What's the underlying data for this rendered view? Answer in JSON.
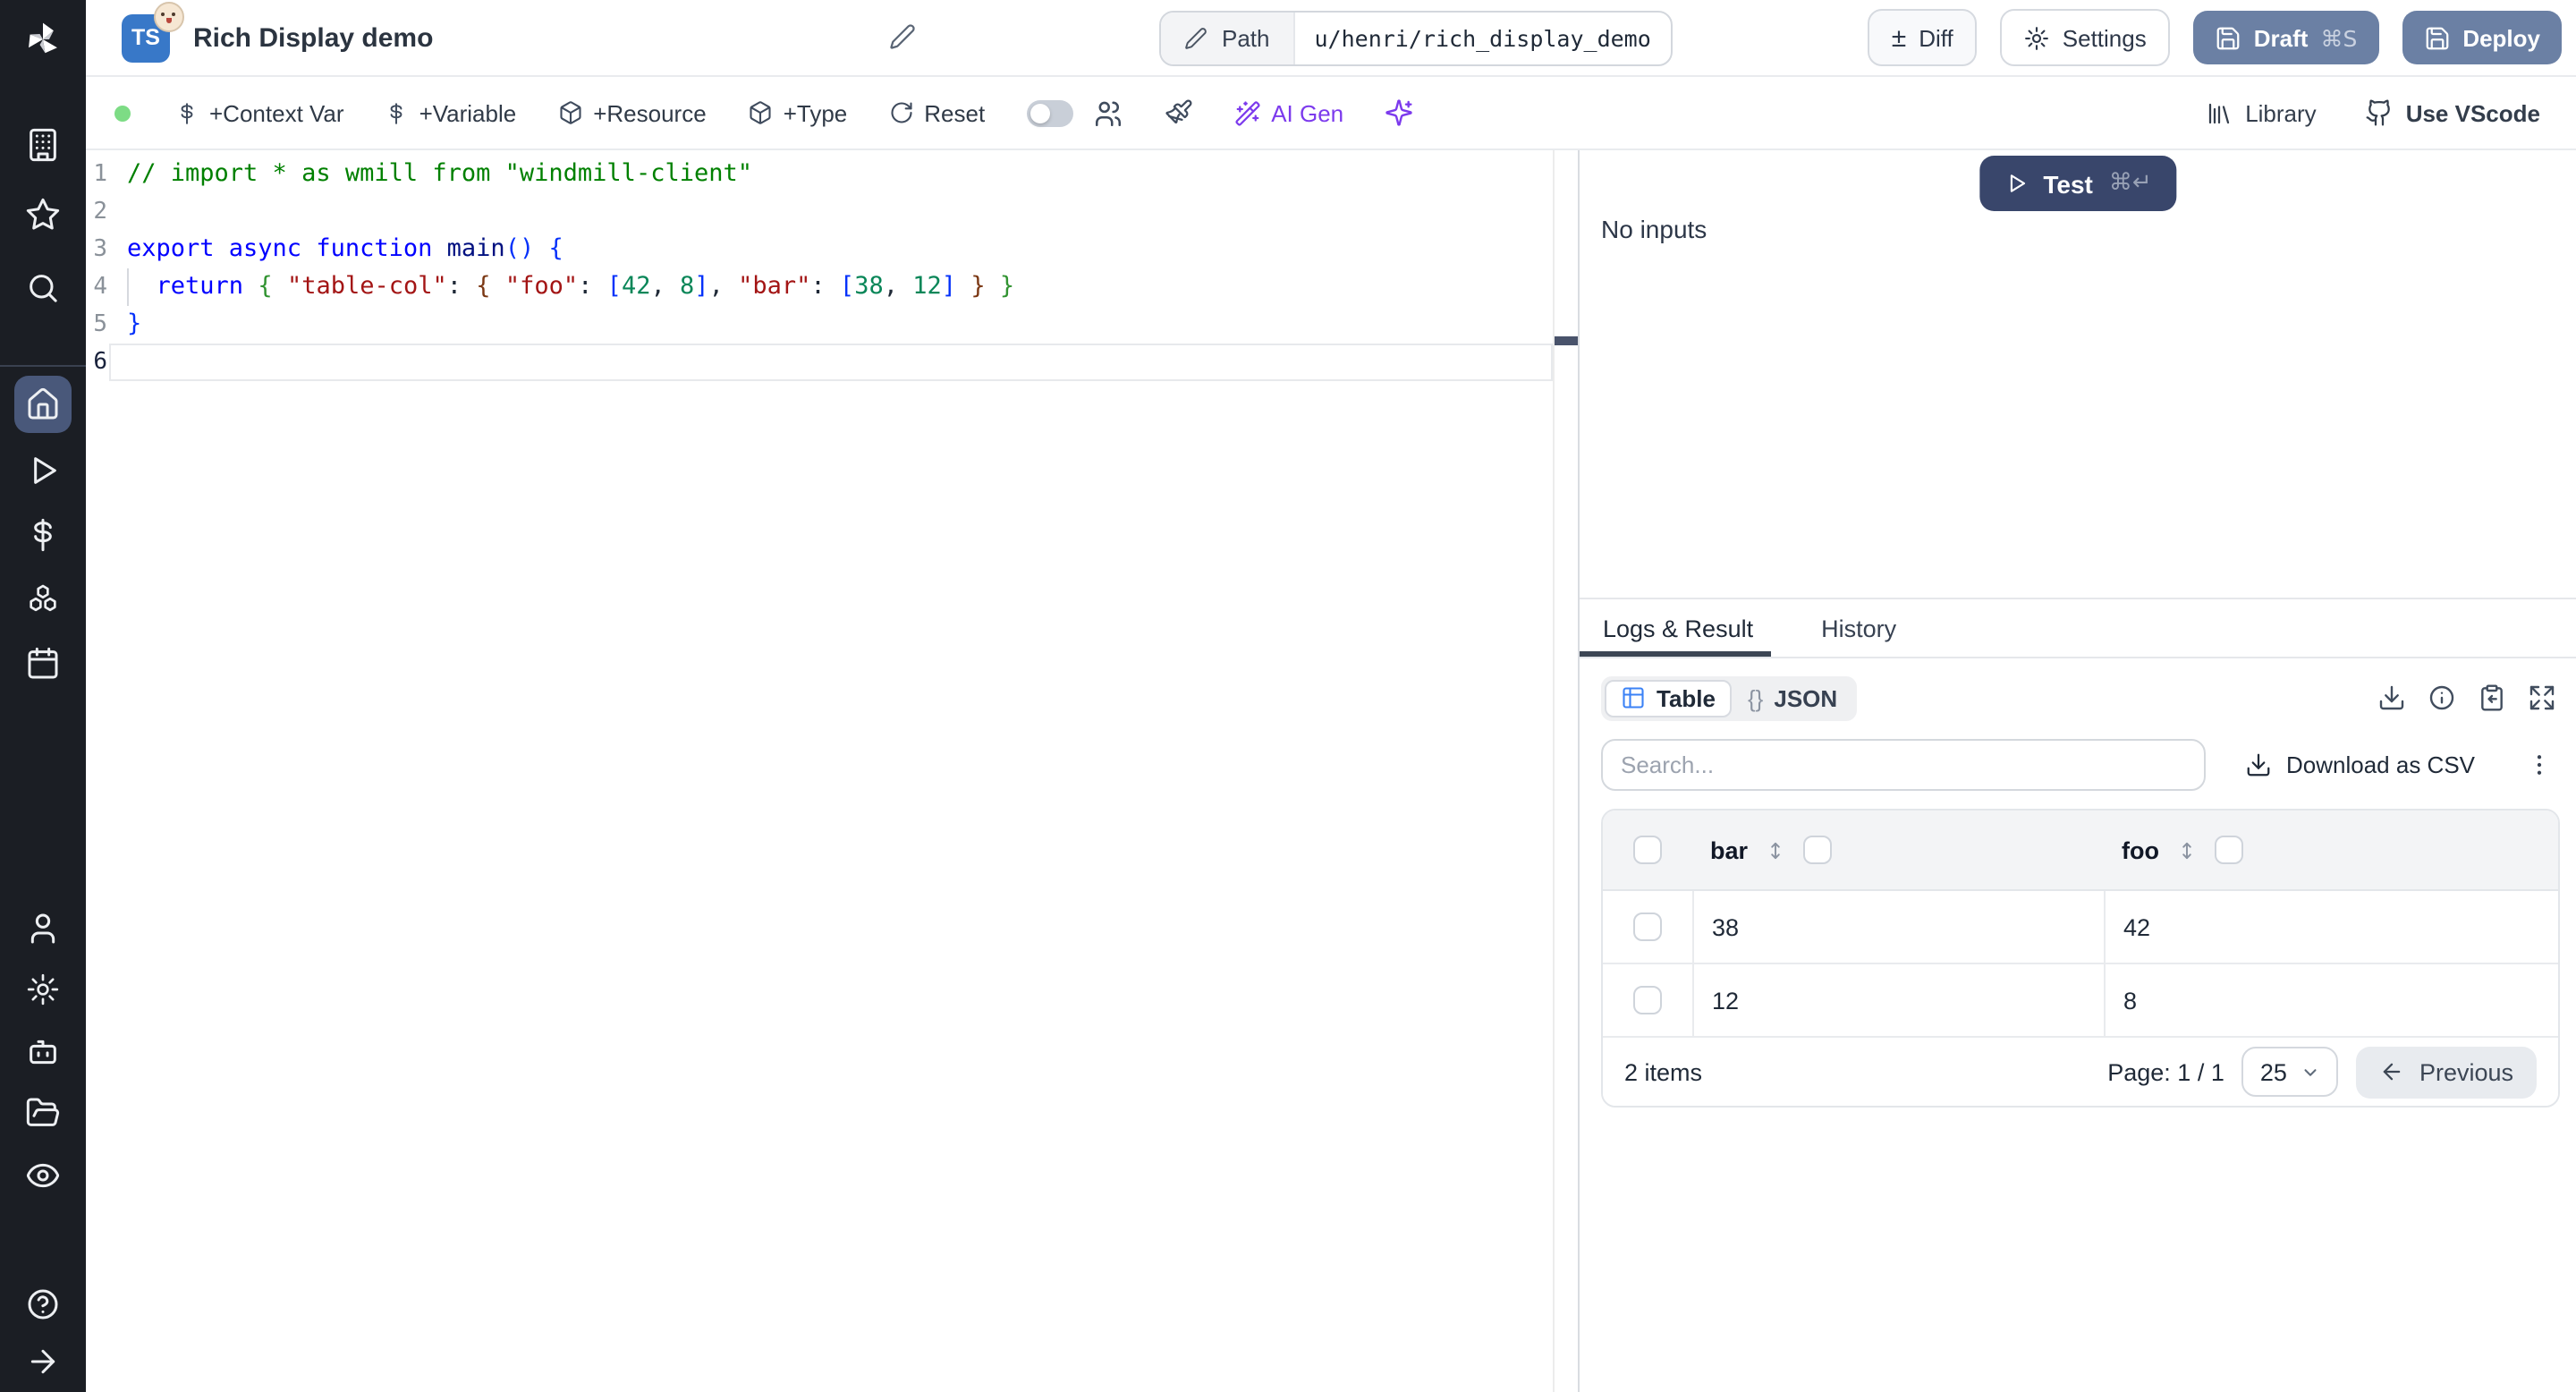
{
  "colors": {
    "sidebar_bg": "#1b1e24",
    "active_nav_bg": "#49587a",
    "primary_button": "#6b80a4",
    "test_button": "#39466b",
    "ai_purple": "#7c3aed",
    "status_green": "#7ddc85",
    "ts_badge_blue": "#3878c8",
    "tab_underline": "#3c4654",
    "table_icon_blue": "#3b82f6"
  },
  "header": {
    "language_badge": "TS",
    "title": "Rich Display demo",
    "path_label": "Path",
    "path_value": "u/henri/rich_display_demo",
    "diff_symbol": "±",
    "diff": "Diff",
    "settings": "Settings",
    "draft": "Draft",
    "draft_shortcut": "⌘S",
    "deploy": "Deploy"
  },
  "toolbar": {
    "context_var": "+Context Var",
    "variable": "+Variable",
    "resource": "+Resource",
    "type": "+Type",
    "reset": "Reset",
    "ai_gen": "AI Gen",
    "library": "Library",
    "use_vscode": "Use VScode"
  },
  "editor": {
    "line_numbers": [
      "1",
      "2",
      "3",
      "4",
      "5",
      "6"
    ],
    "l1": "// import * as wmill from \"windmill-client\"",
    "l3": [
      {
        "t": "export async function"
      },
      {
        "t": " "
      },
      {
        "t": "main"
      },
      {
        "t": "()"
      },
      {
        "t": " "
      },
      {
        "t": "{"
      }
    ],
    "l4": [
      {
        "t": "  "
      },
      {
        "t": "return"
      },
      {
        "t": " "
      },
      {
        "t": "{"
      },
      {
        "t": " "
      },
      {
        "t": "\"table-col\""
      },
      {
        "t": ": "
      },
      {
        "t": "{"
      },
      {
        "t": " "
      },
      {
        "t": "\"foo\""
      },
      {
        "t": ": "
      },
      {
        "t": "["
      },
      {
        "t": "42"
      },
      {
        "t": ", "
      },
      {
        "t": "8"
      },
      {
        "t": "]"
      },
      {
        "t": ", "
      },
      {
        "t": "\"bar\""
      },
      {
        "t": ": "
      },
      {
        "t": "["
      },
      {
        "t": "38"
      },
      {
        "t": ", "
      },
      {
        "t": "12"
      },
      {
        "t": "]"
      },
      {
        "t": " "
      },
      {
        "t": "}"
      },
      {
        "t": " "
      },
      {
        "t": "}"
      }
    ],
    "l5": "}"
  },
  "test_panel": {
    "test": "Test",
    "shortcut": "⌘↵",
    "no_inputs": "No inputs"
  },
  "result_panel": {
    "tab_logs": "Logs & Result",
    "tab_history": "History",
    "view_table": "Table",
    "braces": "{}",
    "view_json": "JSON",
    "search_placeholder": "Search...",
    "download_csv": "Download as CSV",
    "table": {
      "columns": [
        "bar",
        "foo"
      ],
      "rows": [
        {
          "bar": "38",
          "foo": "42"
        },
        {
          "bar": "12",
          "foo": "8"
        }
      ]
    },
    "footer": {
      "items": "2 items",
      "page": "Page: 1 / 1",
      "page_size": "25",
      "previous": "Previous"
    }
  }
}
